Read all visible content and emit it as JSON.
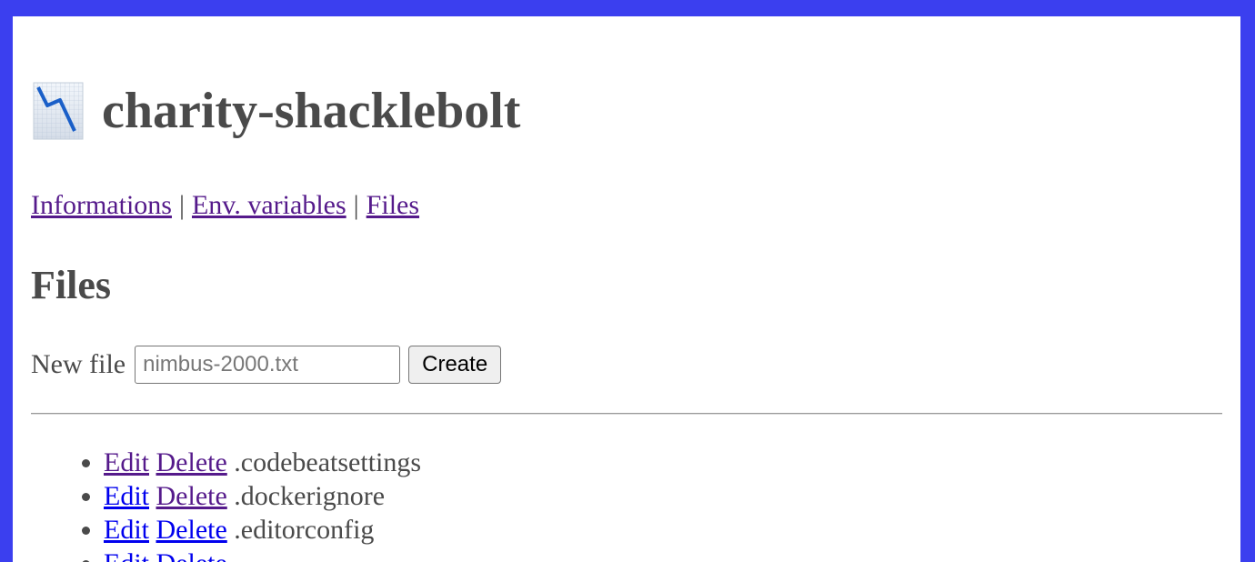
{
  "app": {
    "title": "charity-shacklebolt",
    "icon": "chart-decreasing-icon"
  },
  "nav": {
    "items": [
      "Informations",
      "Env. variables",
      "Files"
    ],
    "separator": "|"
  },
  "section": {
    "title": "Files"
  },
  "new_file": {
    "label": "New file",
    "placeholder": "nimbus-2000.txt",
    "value": "",
    "create_label": "Create"
  },
  "files": [
    {
      "edit": "Edit",
      "delete": "Delete",
      "name": ".codebeatsettings"
    },
    {
      "edit": "Edit",
      "delete": "Delete",
      "name": ".dockerignore"
    },
    {
      "edit": "Edit",
      "delete": "Delete",
      "name": ".editorconfig"
    },
    {
      "edit": "Edit",
      "delete": "Delete",
      "name": ""
    }
  ],
  "colors": {
    "frame": "#3b3fef",
    "visited_link": "#551a8b",
    "link": "#0000ee",
    "text": "#4a4a4a"
  }
}
